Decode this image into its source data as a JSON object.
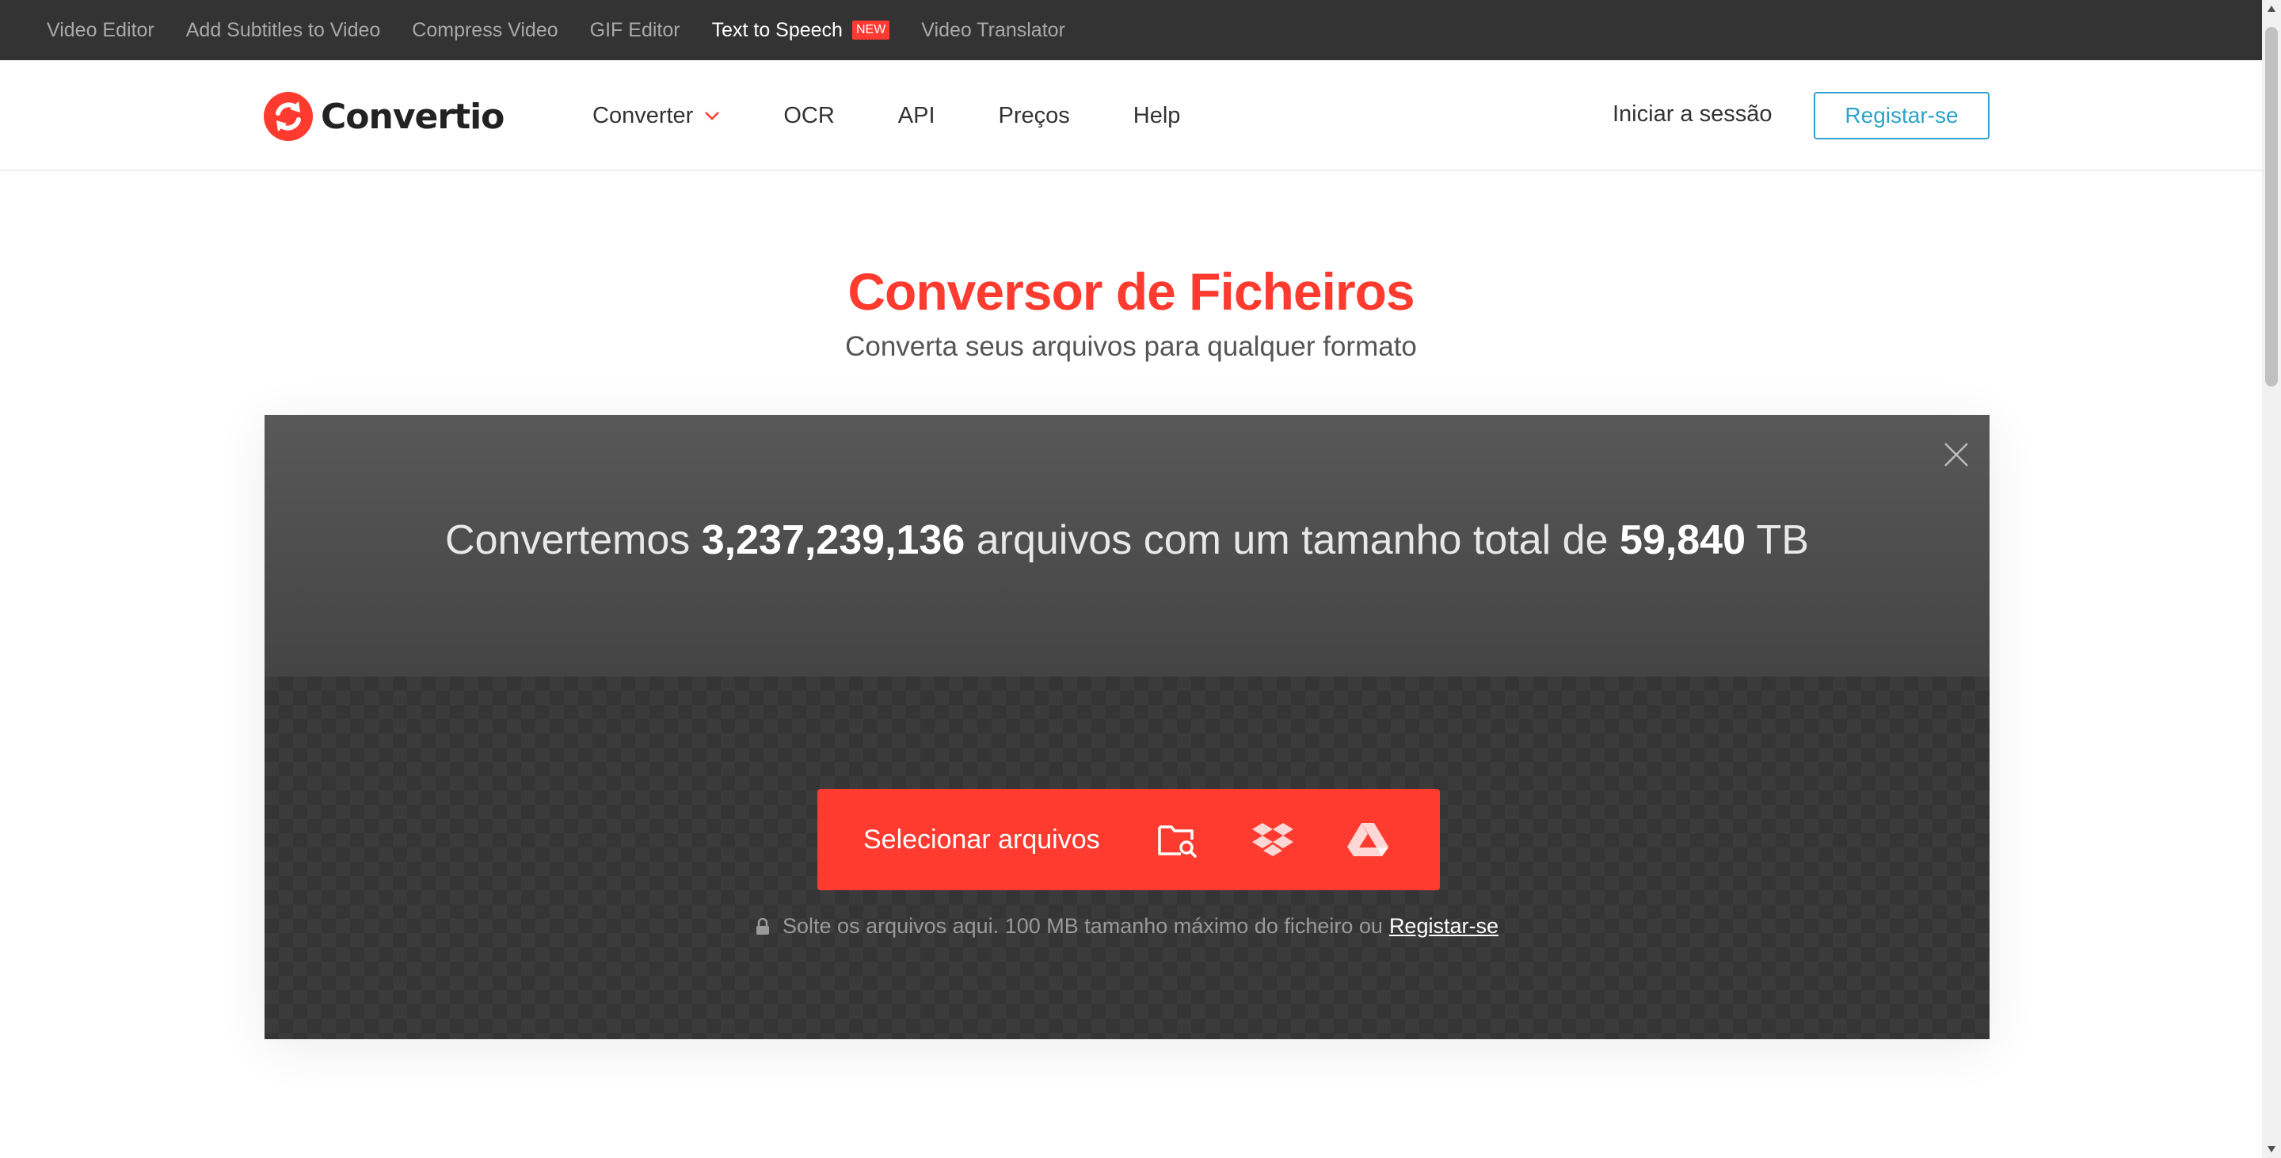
{
  "topbar": {
    "links": [
      {
        "label": "Video Editor"
      },
      {
        "label": "Add Subtitles to Video"
      },
      {
        "label": "Compress Video"
      },
      {
        "label": "GIF Editor"
      },
      {
        "label": "Text to Speech",
        "badge": "NEW"
      },
      {
        "label": "Video Translator"
      }
    ]
  },
  "header": {
    "brand": "Convertio",
    "nav": [
      {
        "label": "Converter",
        "icon": "chevron-down-icon"
      },
      {
        "label": "OCR"
      },
      {
        "label": "API"
      },
      {
        "label": "Preços"
      },
      {
        "label": "Help"
      }
    ],
    "login_label": "Iniciar a sessão",
    "register_label": "Registar-se"
  },
  "hero": {
    "title": "Conversor de Ficheiros",
    "subtitle": "Converta seus arquivos para qualquer formato"
  },
  "stats": {
    "prefix": "Convertemos",
    "files_count": "3,237,239,136",
    "middle": "arquivos com um tamanho total de",
    "total_size": "59,840",
    "unit": "TB"
  },
  "upload": {
    "button_label": "Selecionar arquivos",
    "sources": [
      "folder-search-icon",
      "dropbox-icon",
      "google-drive-icon"
    ],
    "note": "Solte os arquivos aqui. 100 MB tamanho máximo do ficheiro ou",
    "note_link": "Registar-se"
  },
  "colors": {
    "accent": "#ff3b30",
    "link_blue": "#2ca4c9",
    "topbar_bg": "#333333",
    "panel_bg": "#444444"
  }
}
